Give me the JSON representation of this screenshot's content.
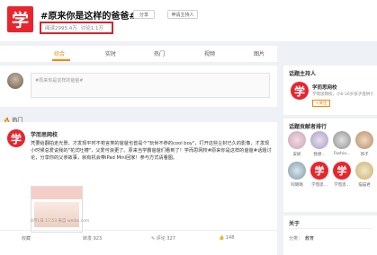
{
  "header": {
    "logo_char": "学",
    "title": "#原来你是这样的爸爸#",
    "btn_share": "分享",
    "btn_apply": "申请主持人",
    "reads": "阅读2995.4万",
    "discussions": "讨论1.1万"
  },
  "tabs": [
    "综合",
    "实时",
    "热门",
    "视频",
    "图片"
  ],
  "composer": {
    "placeholder": "#原来你是这样的爸爸#"
  },
  "hot_label": "热门",
  "post": {
    "author": "学而思网校",
    "body": "凭要给翻拍走光景，才发现平时不苟言笑的爸爸也曾是个\"玩世不恭的cool boy\"，打开这些尘封已久的影像，才发现小时候总爱说我的\"花式吐槽\"，父爱可浪更了。原来当学霸爸爸们看到了！学而思网校#原来你是这样的爸爸#话题讨论，分享你的父亲故事，就有机会带iPad Mini回家！参与方式请看图。",
    "meta": "8月1日 17:53 来自 weibo.com",
    "actions": {
      "collect": "收藏",
      "repost": "转发 923",
      "comment": "评论 327",
      "like": "148"
    }
  },
  "host": {
    "title": "话题主持人",
    "name": "学而思网校",
    "desc": "学而思网校，小6-16岁孩子提供小初...",
    "follow": "+关注"
  },
  "contrib": {
    "title": "话题贡献者排行",
    "users": [
      {
        "name": "安妮"
      },
      {
        "name": "我想..."
      },
      {
        "name": "Fashio..."
      },
      {
        "name": "郭子"
      },
      {
        "name": "阿璐璐"
      },
      {
        "name": "学而思..."
      },
      {
        "name": "学而思..."
      },
      {
        "name": "猫猫君"
      }
    ]
  },
  "about": {
    "title": "关于",
    "category_label": "分类：",
    "category": "教育"
  }
}
